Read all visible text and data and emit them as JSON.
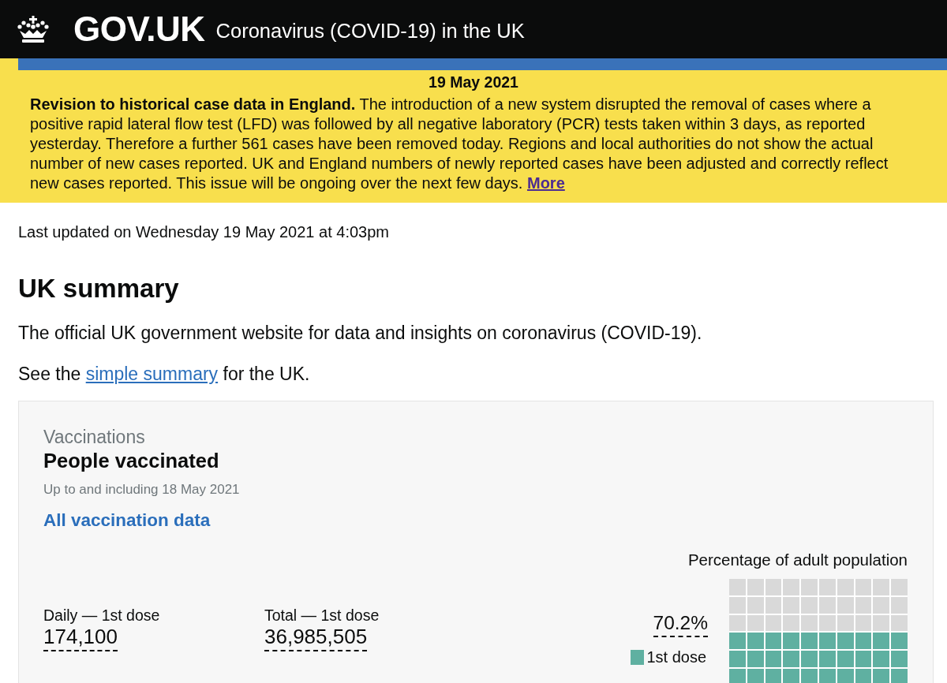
{
  "header": {
    "logo": "GOV.UK",
    "title": "Coronavirus (COVID-19) in the UK"
  },
  "announcement": {
    "date": "19 May 2021",
    "text": "**Revision to historical case data in England.** The introduction of a new system disrupted the removal of cases where a positive rapid lateral flow test (LFD) was followed by all negative laboratory (PCR) tests taken within 3 days, as reported yesterday. Therefore a further 561 cases have been removed today. Regions and local authorities do not show the actual number of new cases reported. UK and England numbers of newly reported cases have been adjusted and correctly reflect new cases reported. This issue will be ongoing over the next few days.",
    "link": "More"
  },
  "last_updated": "Last updated on Wednesday 19 May 2021 at 4:03pm",
  "heading": "UK summary",
  "intro": "The official UK government website for data and insights on coronavirus (COVID-19).",
  "summary_line": {
    "text": "See the",
    "link": "simple summary",
    "after": "for the UK."
  },
  "card": {
    "category": "Vaccinations",
    "title": "People vaccinated",
    "date_note": "Up to and including 18 May 2021",
    "link": "All vaccination data",
    "metrics": [
      {
        "label": "Daily — 1st dose",
        "value": "174,100"
      },
      {
        "label": "Total — 1st dose",
        "value": "36,985,505"
      }
    ],
    "waffle": {
      "title": "Percentage of adult population",
      "value": "70.2%",
      "legend": "1st dose",
      "level": 0.702
    }
  }
}
